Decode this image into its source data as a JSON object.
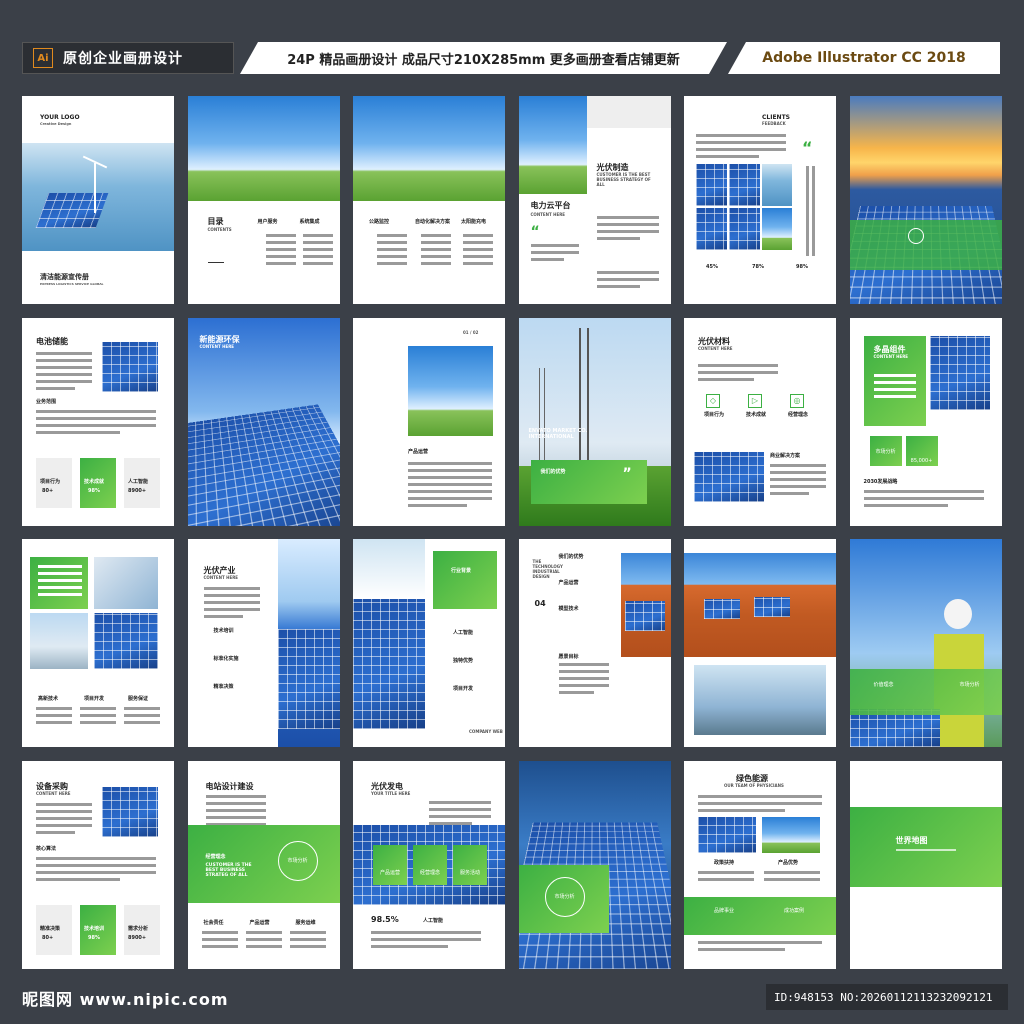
{
  "header": {
    "app_icon": "Ai",
    "left_title": "原创企业画册设计",
    "middle_title": "24P 精品画册设计 成品尺寸210X285mm 更多画册查看店铺更新",
    "right_title": "Adobe Illustrator CC 2018"
  },
  "pages": {
    "p1": {
      "logo": "YOUR LOGO",
      "logo_sub": "Creative Design",
      "title": "清洁能源宣传册",
      "sub": "EXPRESS LOGISTICS SERVICE GLOBAL"
    },
    "p2": {
      "title": "目录",
      "sub": "CONTENTS",
      "col1": "用户服务",
      "col2": "系统集成"
    },
    "p3": {
      "col1": "公路监控",
      "col2": "自动化解决方案",
      "col3": "太阳能充电"
    },
    "p4": {
      "title": "电力云平台",
      "sub": "CONTENT HERE",
      "title2": "光伏制造",
      "sub2": "CUSTOMER IS THE BEST BUSINESS STRATEGY OF ALL"
    },
    "p5": {
      "title": "CLIENTS",
      "sub": "FEEDBACK",
      "stat1": "45%",
      "stat2": "78%",
      "stat3": "98%"
    },
    "p7": {
      "title": "电池储能",
      "section": "业务范围",
      "s1_label": "项目行为",
      "s1_val": "80+",
      "s2_label": "技术成就",
      "s2_val": "98%",
      "s3_label": "人工智能",
      "s3_val": "8900+"
    },
    "p8": {
      "title": "新能源环保",
      "sub": "CONTENT HERE"
    },
    "p9": {
      "page_no": "01 / 02",
      "caption": "产品运营"
    },
    "p10": {
      "overlay": "ENVATO MARKET CO. INTERNATIONAL",
      "box": "我们的优势"
    },
    "p11": {
      "title": "光伏材料",
      "sub": "CONTENT HERE",
      "i1": "项目行为",
      "i2": "技术成就",
      "i3": "经营理念",
      "caption": "商业解决方案"
    },
    "p12": {
      "title": "多晶组件",
      "sub": "CONTENT HERE",
      "b1": "市场分析",
      "b2": "85,000+",
      "caption": "2030发展战略"
    },
    "p13": {
      "a1": "高新技术",
      "a2": "项目开发",
      "a3": "服务保证"
    },
    "p14": {
      "title": "光伏产业",
      "sub": "CONTENT HERE",
      "l1": "技术培训",
      "l2": "标准化实施",
      "l3": "精准决策"
    },
    "p15": {
      "box": "行业背景",
      "l1": "人工智能",
      "l2": "独特优势",
      "l3": "项目开发",
      "footer": "COMPANY WEB"
    },
    "p16": {
      "num": "04",
      "vertical": "THE TECHNOLOGY INDUSTRIAL DESIGN",
      "l1": "我们的优势",
      "l2": "产品运营",
      "l3": "模型技术",
      "l4": "愿景目标"
    },
    "p18": {
      "b1": "价值理念",
      "b2": "市场分析"
    },
    "p19": {
      "title": "设备采购",
      "sub": "CONTENT HERE",
      "section": "核心算法",
      "s1_label": "精准决策",
      "s1_val": "80+",
      "s2_label": "技术培训",
      "s2_val": "98%",
      "s3_label": "需求分析",
      "s3_val": "8900+"
    },
    "p20": {
      "title": "电站设计建设",
      "band_title": "经营理念",
      "band_sub": "CUSTOMER IS THE BEST BUSINESS STRATEG OF ALL",
      "circle": "市场分析",
      "a1": "社会责任",
      "a2": "产品运营",
      "a3": "服务运维"
    },
    "p21": {
      "title": "光伏发电",
      "sub": "YOUR TITLE HERE",
      "b1": "产品运营",
      "b2": "经营理念",
      "b3": "服务活动",
      "stat": "98.5%",
      "stat_label": "人工智能"
    },
    "p22": {
      "circle": "市场分析"
    },
    "p23": {
      "title": "绿色能源",
      "sub": "OUR TEAM OF PHYSICIANS",
      "c1": "政策扶持",
      "c2": "产品优势",
      "g1": "品牌事业",
      "g2": "成功案例"
    },
    "p24": {
      "title": "世界地图"
    }
  },
  "footer": {
    "watermark": "昵图网 www.nipic.com",
    "id_text": "ID:948153 NO:20260112113232092121"
  }
}
